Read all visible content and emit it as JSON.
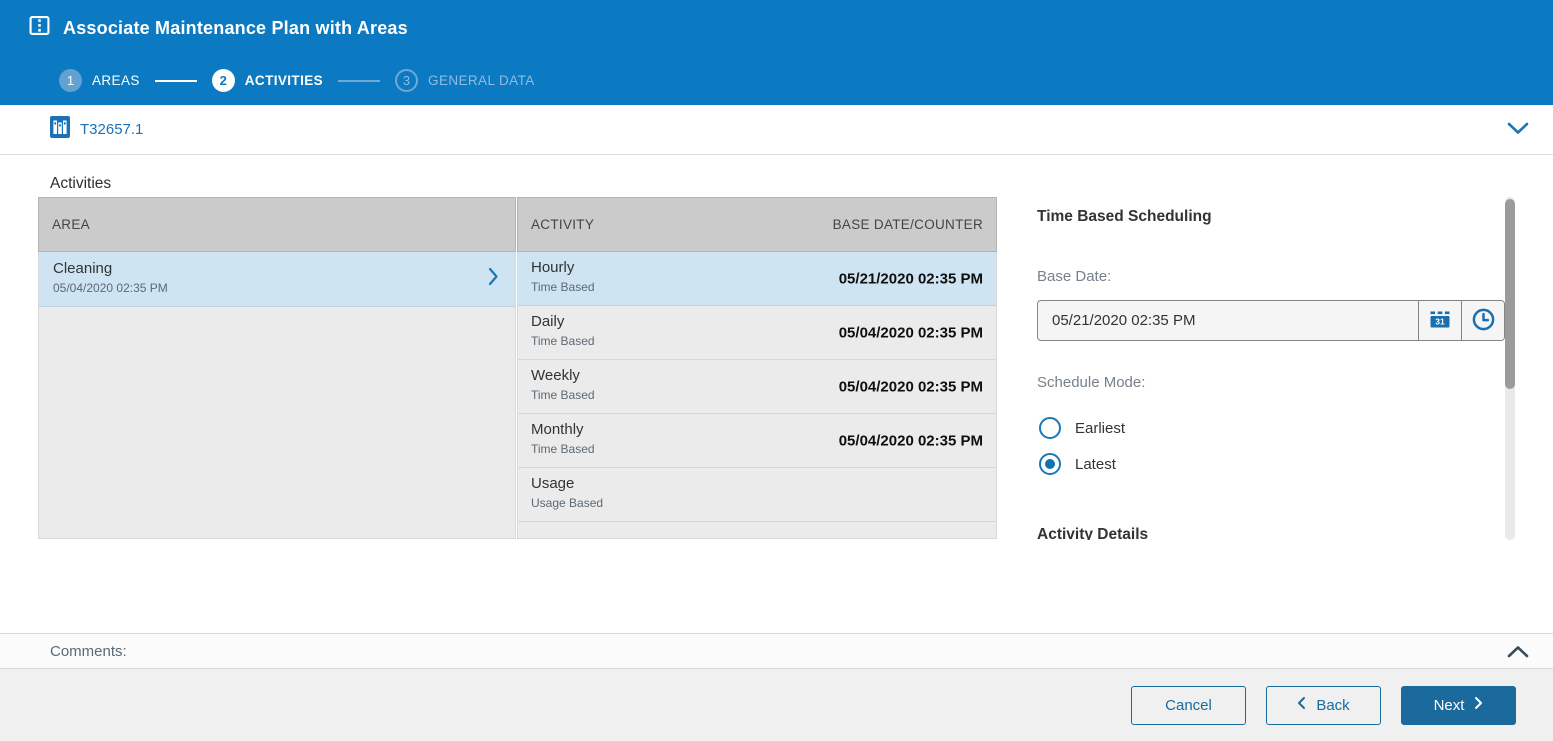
{
  "header": {
    "title": "Associate Maintenance Plan with Areas",
    "steps": [
      {
        "num": "1",
        "label": "AREAS"
      },
      {
        "num": "2",
        "label": "ACTIVITIES"
      },
      {
        "num": "3",
        "label": "GENERAL DATA"
      }
    ]
  },
  "context_bar": {
    "plan_id": "T32657.1"
  },
  "activities": {
    "section_label": "Activities",
    "area_column": {
      "header": "AREA",
      "rows": [
        {
          "name": "Cleaning",
          "date": "05/04/2020 02:35 PM",
          "selected": true
        }
      ]
    },
    "activity_column": {
      "header_activity": "ACTIVITY",
      "header_base": "BASE DATE/COUNTER",
      "rows": [
        {
          "name": "Hourly",
          "type": "Time Based",
          "date": "05/21/2020 02:35 PM",
          "selected": true
        },
        {
          "name": "Daily",
          "type": "Time Based",
          "date": "05/04/2020 02:35 PM",
          "selected": false
        },
        {
          "name": "Weekly",
          "type": "Time Based",
          "date": "05/04/2020 02:35 PM",
          "selected": false
        },
        {
          "name": "Monthly",
          "type": "Time Based",
          "date": "05/04/2020 02:35 PM",
          "selected": false
        },
        {
          "name": "Usage",
          "type": "Usage Based",
          "date": "",
          "selected": false
        }
      ]
    }
  },
  "scheduling": {
    "title": "Time Based Scheduling",
    "base_date_label": "Base Date:",
    "base_date_value": "05/21/2020 02:35 PM",
    "schedule_mode_label": "Schedule Mode:",
    "options": [
      {
        "label": "Earliest",
        "selected": false
      },
      {
        "label": "Latest",
        "selected": true
      }
    ],
    "details_title": "Activity Details"
  },
  "comments": {
    "label": "Comments:"
  },
  "footer": {
    "cancel_label": "Cancel",
    "back_label": "Back",
    "next_label": "Next"
  },
  "colors": {
    "brand": "#0b7ac2",
    "accent": "#1a6a9e",
    "selected_row": "#cfe4f3",
    "grid_header": "#cbcbcb",
    "grid_body": "#ebebeb"
  }
}
